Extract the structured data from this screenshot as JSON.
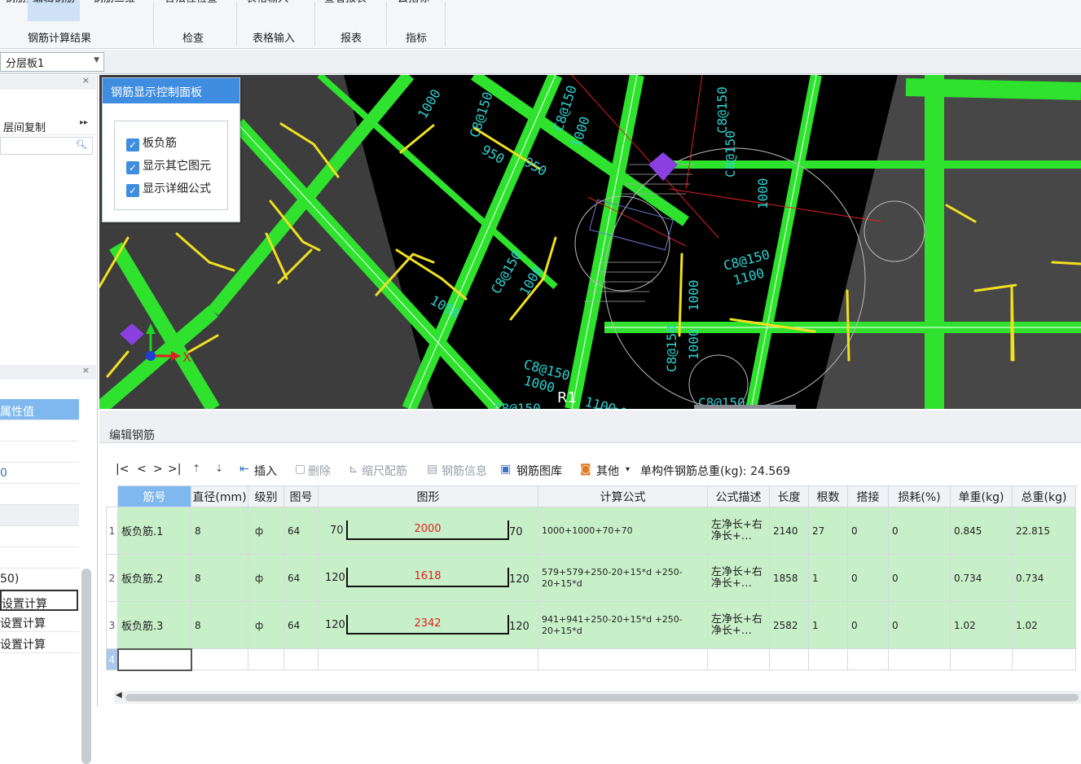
{
  "ribbon": {
    "buttons": [
      "钢筋量",
      "编辑钢筋",
      "钢筋三维",
      "合法性检查",
      "表格输入",
      "查看报表",
      "云指标"
    ],
    "groups": [
      "钢筋计算结果",
      "检查",
      "表格输入",
      "报表",
      "指标"
    ]
  },
  "floor_select": {
    "value": "分层板1"
  },
  "left_panel": {
    "copy_label": "层间复制",
    "rows": [
      "属性值",
      "",
      "",
      "0",
      "",
      "",
      "",
      "",
      "50)",
      "设置计算",
      "设置计算",
      "设置计算"
    ]
  },
  "control_panel": {
    "title": "钢筋显示控制面板",
    "options": [
      {
        "label": "板负筋",
        "checked": true
      },
      {
        "label": "显示其它图元",
        "checked": true
      },
      {
        "label": "显示详细公式",
        "checked": true
      }
    ]
  },
  "cad": {
    "labels": [
      "C8@150",
      "950",
      "950",
      "1000",
      "C8@150",
      "1000",
      "1050",
      "C8@150",
      "1000",
      "C8@150",
      "1000",
      "C8@150",
      "1100",
      "C8@150",
      "1000",
      "1000",
      "C8@150",
      "1000",
      "C8@150",
      "1000",
      "C8@150",
      "R1",
      "1100",
      "C8@150"
    ],
    "axis_x": "X"
  },
  "edit": {
    "title": "编辑钢筋",
    "toolbar": {
      "nav": [
        "|<",
        "<",
        ">",
        ">|"
      ],
      "insert": "插入",
      "delete": "删除",
      "scale": "缩尺配筋",
      "info": "钢筋信息",
      "library": "钢筋图库",
      "other": "其他",
      "total_label": "单构件钢筋总重(kg): 24.569"
    },
    "columns": [
      "筋号",
      "直径(mm)",
      "级别",
      "图号",
      "图形",
      "计算公式",
      "公式描述",
      "长度",
      "根数",
      "搭接",
      "损耗(%)",
      "单重(kg)",
      "总重(kg)"
    ],
    "rows": [
      {
        "rn": "1",
        "name": "板负筋.1",
        "dia": "8",
        "grade": "ф",
        "fig": "64",
        "left": "70",
        "mid": "2000",
        "right": "70",
        "formula": "1000+1000+70+70",
        "desc": "左净长+右净长+…",
        "len": "2140",
        "count": "27",
        "lap": "0",
        "loss": "0",
        "unit": "0.845",
        "total": "22.815"
      },
      {
        "rn": "2",
        "name": "板负筋.2",
        "dia": "8",
        "grade": "ф",
        "fig": "64",
        "left": "120",
        "mid": "1618",
        "right": "120",
        "formula": "579+579+250-20+15*d +250-20+15*d",
        "desc": "左净长+右净长+…",
        "len": "1858",
        "count": "1",
        "lap": "0",
        "loss": "0",
        "unit": "0.734",
        "total": "0.734"
      },
      {
        "rn": "3",
        "name": "板负筋.3",
        "dia": "8",
        "grade": "ф",
        "fig": "64",
        "left": "120",
        "mid": "2342",
        "right": "120",
        "formula": "941+941+250-20+15*d +250-20+15*d",
        "desc": "左净长+右净长+…",
        "len": "2582",
        "count": "1",
        "lap": "0",
        "loss": "0",
        "unit": "1.02",
        "total": "1.02"
      }
    ],
    "empty_row_number": "4"
  }
}
